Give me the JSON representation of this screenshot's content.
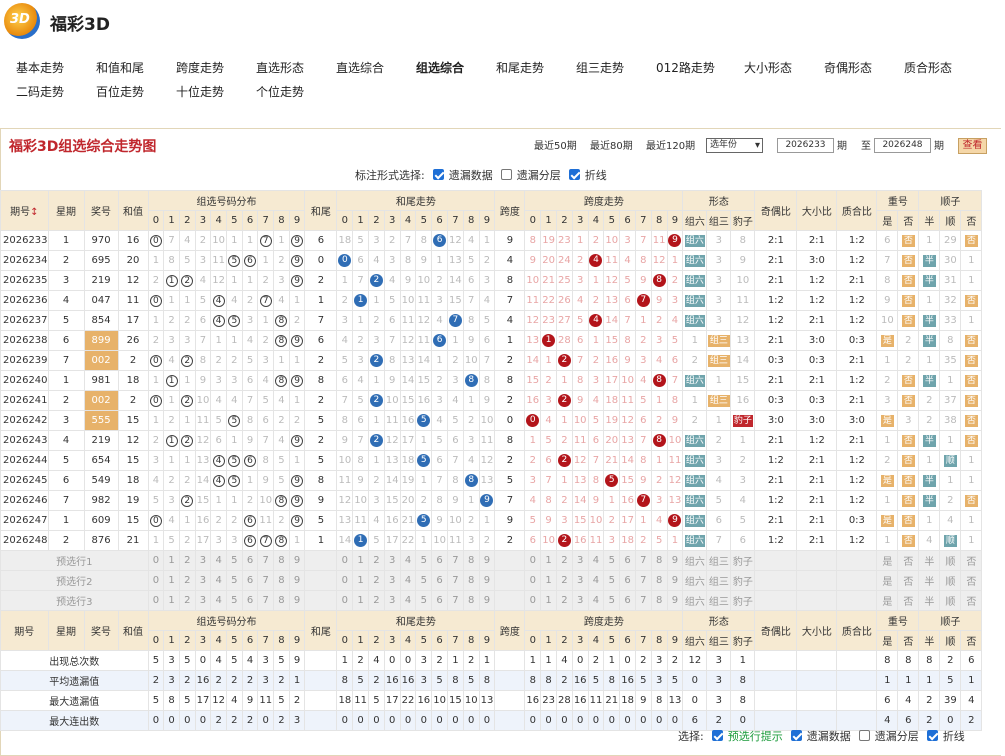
{
  "app": {
    "title": "福彩3D",
    "logo_text": "3D"
  },
  "nav": [
    "基本走势",
    "和值和尾",
    "跨度走势",
    "直选形态",
    "直选综合",
    "组选综合",
    "和尾走势",
    "组三走势",
    "012路走势",
    "大小形态",
    "奇偶形态",
    "质合形态",
    "二码走势",
    "百位走势",
    "十位走势",
    "个位走势"
  ],
  "nav_active": "组选综合",
  "panel": {
    "title": "福彩3D组选综合走势图",
    "recent": [
      "最近50期",
      "最近80期",
      "最近120期"
    ],
    "year_select": "选年份",
    "from": "2026233",
    "period_label": "期",
    "to_label": "至",
    "to": "2026248",
    "query": "查看"
  },
  "mark": {
    "label": "标注形式选择:",
    "opts": [
      {
        "label": "遗漏数据",
        "on": true
      },
      {
        "label": "遗漏分层",
        "on": false
      },
      {
        "label": "折线",
        "on": true
      }
    ]
  },
  "headers": {
    "issue": "期号",
    "week": "星期",
    "prize": "奖号",
    "sum": "和值",
    "dist": "组选号码分布",
    "tail": "和尾",
    "tail_trend": "和尾走势",
    "span": "跨度",
    "span_trend": "跨度走势",
    "form": "形态",
    "form_cols": [
      "组六",
      "组三",
      "豹子"
    ],
    "oe": "奇偶比",
    "bs": "大小比",
    "pc": "质合比",
    "dup": "重号",
    "dup_cols": [
      "是",
      "否"
    ],
    "order": "顺子",
    "order_cols": [
      "半",
      "顺",
      "否"
    ],
    "digits": [
      "0",
      "1",
      "2",
      "3",
      "4",
      "5",
      "6",
      "7",
      "8",
      "9"
    ]
  },
  "rows": [
    {
      "issue": "2026233",
      "week": "1",
      "prize": "970",
      "sum": "16",
      "dist": [
        "⓪",
        "7",
        "4",
        "2",
        "10",
        "1",
        "1",
        "⑦",
        "1",
        "⑨"
      ],
      "tail": "6",
      "tt": [
        "18",
        "5",
        "3",
        "2",
        "7",
        "8",
        "6*",
        "12",
        "4",
        "1"
      ],
      "span": "9",
      "st": [
        "8",
        "19",
        "23",
        "1",
        "2",
        "10",
        "3",
        "7",
        "11",
        "9*"
      ],
      "form": [
        "组六",
        "3",
        "8"
      ],
      "oe": "2:1",
      "bs": "2:1",
      "pc": "1:2",
      "dup": [
        "6",
        "否"
      ],
      "order": [
        "1",
        "29",
        "否"
      ]
    },
    {
      "issue": "2026234",
      "week": "2",
      "prize": "695",
      "sum": "20",
      "dist": [
        "1",
        "8",
        "5",
        "3",
        "11",
        "⑤",
        "⑥",
        "1",
        "2",
        "⑨"
      ],
      "tail": "0",
      "tt": [
        "0*",
        "6",
        "4",
        "3",
        "8",
        "9",
        "1",
        "13",
        "5",
        "2"
      ],
      "span": "4",
      "st": [
        "9",
        "20",
        "24",
        "2",
        "4*",
        "11",
        "4",
        "8",
        "12",
        "1"
      ],
      "form": [
        "组六",
        "3",
        "9"
      ],
      "oe": "2:1",
      "bs": "3:0",
      "pc": "1:2",
      "dup": [
        "7",
        "否"
      ],
      "order": [
        "半",
        "30",
        "1"
      ]
    },
    {
      "issue": "2026235",
      "week": "3",
      "prize": "219",
      "sum": "12",
      "dist": [
        "2",
        "①",
        "②",
        "4",
        "12",
        "1",
        "1",
        "2",
        "3",
        "⑨"
      ],
      "tail": "2",
      "tt": [
        "1",
        "7",
        "2*",
        "4",
        "9",
        "10",
        "2",
        "14",
        "6",
        "3"
      ],
      "span": "8",
      "st": [
        "10",
        "21",
        "25",
        "3",
        "1",
        "12",
        "5",
        "9",
        "8*",
        "2"
      ],
      "form": [
        "组六",
        "3",
        "10"
      ],
      "oe": "2:1",
      "bs": "1:2",
      "pc": "2:1",
      "dup": [
        "8",
        "否"
      ],
      "order": [
        "半",
        "31",
        "1"
      ]
    },
    {
      "issue": "2026236",
      "week": "4",
      "prize": "047",
      "sum": "11",
      "dist": [
        "⓪",
        "1",
        "1",
        "5",
        "④",
        "4",
        "2",
        "⑦",
        "4",
        "1"
      ],
      "tail": "1",
      "tt": [
        "2",
        "1*",
        "1",
        "5",
        "10",
        "11",
        "3",
        "15",
        "7",
        "4"
      ],
      "span": "7",
      "st": [
        "11",
        "22",
        "26",
        "4",
        "2",
        "13",
        "6",
        "7*",
        "9",
        "3"
      ],
      "form": [
        "组六",
        "3",
        "11"
      ],
      "oe": "1:2",
      "bs": "1:2",
      "pc": "1:2",
      "dup": [
        "9",
        "否"
      ],
      "order": [
        "1",
        "32",
        "否"
      ]
    },
    {
      "issue": "2026237",
      "week": "5",
      "prize": "854",
      "sum": "17",
      "dist": [
        "1",
        "2",
        "2",
        "6",
        "④",
        "⑤",
        "3",
        "1",
        "⑧",
        "2"
      ],
      "tail": "7",
      "tt": [
        "3",
        "1",
        "2",
        "6",
        "11",
        "12",
        "4",
        "7*",
        "8",
        "5"
      ],
      "span": "4",
      "st": [
        "12",
        "23",
        "27",
        "5",
        "4*",
        "14",
        "7",
        "1",
        "2",
        "4"
      ],
      "form": [
        "组六",
        "3",
        "12"
      ],
      "oe": "1:2",
      "bs": "2:1",
      "pc": "1:2",
      "dup": [
        "10",
        "否"
      ],
      "order": [
        "半",
        "33",
        "1"
      ]
    },
    {
      "issue": "2026238",
      "week": "6",
      "prize": "899",
      "sum": "26",
      "dist": [
        "2",
        "3",
        "3",
        "7",
        "1",
        "1",
        "4",
        "2",
        "⑧",
        "⑨"
      ],
      "tail": "6",
      "tt": [
        "4",
        "2",
        "3",
        "7",
        "12",
        "11",
        "6*",
        "1",
        "9",
        "6"
      ],
      "span": "1",
      "st": [
        "13",
        "1*",
        "28",
        "6",
        "1",
        "15",
        "8",
        "2",
        "3",
        "5"
      ],
      "form": [
        "1",
        "组三",
        "13"
      ],
      "oe": "2:1",
      "bs": "3:0",
      "pc": "0:3",
      "dup": [
        "是",
        "2"
      ],
      "order": [
        "半",
        "8",
        "否"
      ]
    },
    {
      "issue": "2026239",
      "week": "7",
      "prize": "002",
      "sum": "2",
      "dist": [
        "⓪",
        "4",
        "②",
        "8",
        "2",
        "2",
        "5",
        "3",
        "1",
        "1"
      ],
      "tail": "2",
      "tt": [
        "5",
        "3",
        "2*",
        "8",
        "13",
        "14",
        "1",
        "2",
        "10",
        "7"
      ],
      "span": "2",
      "st": [
        "14",
        "1",
        "2*",
        "7",
        "2",
        "16",
        "9",
        "3",
        "4",
        "6"
      ],
      "form": [
        "2",
        "组三",
        "14"
      ],
      "oe": "0:3",
      "bs": "0:3",
      "pc": "2:1",
      "dup": [
        "1",
        "2"
      ],
      "order": [
        "1",
        "35",
        "否"
      ]
    },
    {
      "issue": "2026240",
      "week": "1",
      "prize": "981",
      "sum": "18",
      "dist": [
        "1",
        "①",
        "1",
        "9",
        "3",
        "3",
        "6",
        "4",
        "⑧",
        "⑨"
      ],
      "tail": "8",
      "tt": [
        "6",
        "4",
        "1",
        "9",
        "14",
        "15",
        "2",
        "3",
        "8*",
        "8"
      ],
      "span": "8",
      "st": [
        "15",
        "2",
        "1",
        "8",
        "3",
        "17",
        "10",
        "4",
        "8*",
        "7"
      ],
      "form": [
        "组六",
        "1",
        "15"
      ],
      "oe": "2:1",
      "bs": "2:1",
      "pc": "1:2",
      "dup": [
        "2",
        "否"
      ],
      "order": [
        "半",
        "1",
        "否"
      ]
    },
    {
      "issue": "2026241",
      "week": "2",
      "prize": "002",
      "sum": "2",
      "dist": [
        "⓪",
        "1",
        "②",
        "10",
        "4",
        "4",
        "7",
        "5",
        "4",
        "1"
      ],
      "tail": "2",
      "tt": [
        "7",
        "5",
        "2*",
        "10",
        "15",
        "16",
        "3",
        "4",
        "1",
        "9"
      ],
      "span": "2",
      "st": [
        "16",
        "3",
        "2*",
        "9",
        "4",
        "18",
        "11",
        "5",
        "1",
        "8"
      ],
      "form": [
        "1",
        "组三",
        "16"
      ],
      "oe": "0:3",
      "bs": "0:3",
      "pc": "2:1",
      "dup": [
        "3",
        "否"
      ],
      "order": [
        "2",
        "37",
        "否"
      ]
    },
    {
      "issue": "2026242",
      "week": "3",
      "prize": "555",
      "sum": "15",
      "dist": [
        "1",
        "2",
        "1",
        "11",
        "5",
        "⑤",
        "8",
        "6",
        "2",
        "2"
      ],
      "tail": "5",
      "tt": [
        "8",
        "6",
        "1",
        "11",
        "16",
        "5*",
        "4",
        "5",
        "2",
        "10"
      ],
      "span": "0",
      "st": [
        "0*",
        "4",
        "1",
        "10",
        "5",
        "19",
        "12",
        "6",
        "2",
        "9"
      ],
      "form": [
        "2",
        "1",
        "豹子"
      ],
      "oe": "3:0",
      "bs": "3:0",
      "pc": "3:0",
      "dup": [
        "是",
        "3"
      ],
      "order": [
        "2",
        "38",
        "否"
      ]
    },
    {
      "issue": "2026243",
      "week": "4",
      "prize": "219",
      "sum": "12",
      "dist": [
        "2",
        "①",
        "②",
        "12",
        "6",
        "1",
        "9",
        "7",
        "4",
        "⑨"
      ],
      "tail": "2",
      "tt": [
        "9",
        "7",
        "2*",
        "12",
        "17",
        "1",
        "5",
        "6",
        "3",
        "11"
      ],
      "span": "8",
      "st": [
        "1",
        "5",
        "2",
        "11",
        "6",
        "20",
        "13",
        "7",
        "8*",
        "10"
      ],
      "form": [
        "组六",
        "2",
        "1"
      ],
      "oe": "2:1",
      "bs": "1:2",
      "pc": "2:1",
      "dup": [
        "1",
        "否"
      ],
      "order": [
        "半",
        "1",
        "否"
      ]
    },
    {
      "issue": "2026244",
      "week": "5",
      "prize": "654",
      "sum": "15",
      "dist": [
        "3",
        "1",
        "1",
        "13",
        "④",
        "⑤",
        "⑥",
        "8",
        "5",
        "1"
      ],
      "tail": "5",
      "tt": [
        "10",
        "8",
        "1",
        "13",
        "18",
        "5*",
        "6",
        "7",
        "4",
        "12"
      ],
      "span": "2",
      "st": [
        "2",
        "6",
        "2*",
        "12",
        "7",
        "21",
        "14",
        "8",
        "1",
        "11"
      ],
      "form": [
        "组六",
        "3",
        "2"
      ],
      "oe": "1:2",
      "bs": "2:1",
      "pc": "1:2",
      "dup": [
        "2",
        "否"
      ],
      "order": [
        "1",
        "顺",
        "1"
      ]
    },
    {
      "issue": "2026245",
      "week": "6",
      "prize": "549",
      "sum": "18",
      "dist": [
        "4",
        "2",
        "2",
        "14",
        "④",
        "⑤",
        "1",
        "9",
        "5",
        "⑨"
      ],
      "tail": "8",
      "tt": [
        "11",
        "9",
        "2",
        "14",
        "19",
        "1",
        "7",
        "8",
        "8*",
        "13"
      ],
      "span": "5",
      "st": [
        "3",
        "7",
        "1",
        "13",
        "8",
        "5*",
        "15",
        "9",
        "2",
        "12"
      ],
      "form": [
        "组六",
        "4",
        "3"
      ],
      "oe": "2:1",
      "bs": "2:1",
      "pc": "1:2",
      "dup": [
        "是",
        "否"
      ],
      "order": [
        "半",
        "1",
        "1"
      ]
    },
    {
      "issue": "2026246",
      "week": "7",
      "prize": "982",
      "sum": "19",
      "dist": [
        "5",
        "3",
        "②",
        "15",
        "1",
        "1",
        "2",
        "10",
        "⑧",
        "⑨"
      ],
      "tail": "9",
      "tt": [
        "12",
        "10",
        "3",
        "15",
        "20",
        "2",
        "8",
        "9",
        "1",
        "9*"
      ],
      "span": "7",
      "st": [
        "4",
        "8",
        "2",
        "14",
        "9",
        "1",
        "16",
        "7*",
        "3",
        "13"
      ],
      "form": [
        "组六",
        "5",
        "4"
      ],
      "oe": "1:2",
      "bs": "2:1",
      "pc": "1:2",
      "dup": [
        "1",
        "否"
      ],
      "order": [
        "半",
        "2",
        "否"
      ]
    },
    {
      "issue": "2026247",
      "week": "1",
      "prize": "609",
      "sum": "15",
      "dist": [
        "⓪",
        "4",
        "1",
        "16",
        "2",
        "2",
        "⑥",
        "11",
        "2",
        "⑨"
      ],
      "tail": "5",
      "tt": [
        "13",
        "11",
        "4",
        "16",
        "21",
        "5*",
        "9",
        "10",
        "2",
        "1"
      ],
      "span": "9",
      "st": [
        "5",
        "9",
        "3",
        "15",
        "10",
        "2",
        "17",
        "1",
        "4",
        "9*"
      ],
      "form": [
        "组六",
        "6",
        "5"
      ],
      "oe": "2:1",
      "bs": "2:1",
      "pc": "0:3",
      "dup": [
        "是",
        "否"
      ],
      "order": [
        "1",
        "4",
        "1"
      ]
    },
    {
      "issue": "2026248",
      "week": "2",
      "prize": "876",
      "sum": "21",
      "dist": [
        "1",
        "5",
        "2",
        "17",
        "3",
        "3",
        "⑥",
        "⑦",
        "⑧",
        "1"
      ],
      "tail": "1",
      "tt": [
        "14",
        "1*",
        "5",
        "17",
        "22",
        "1",
        "10",
        "11",
        "3",
        "2"
      ],
      "span": "2",
      "st": [
        "6",
        "10",
        "2*",
        "16",
        "11",
        "3",
        "18",
        "2",
        "5",
        "1"
      ],
      "form": [
        "组六",
        "7",
        "6"
      ],
      "oe": "1:2",
      "bs": "2:1",
      "pc": "1:2",
      "dup": [
        "1",
        "否"
      ],
      "order": [
        "4",
        "顺",
        "1"
      ]
    }
  ],
  "pre_rows": [
    "预选行1",
    "预选行2",
    "预选行3"
  ],
  "pre_dup": [
    "是",
    "否"
  ],
  "pre_order": [
    "半",
    "顺",
    "否"
  ],
  "stats": [
    {
      "label": "出现总次数",
      "dist": [
        "5",
        "3",
        "5",
        "0",
        "4",
        "5",
        "4",
        "3",
        "5",
        "9"
      ],
      "tt": [
        "1",
        "2",
        "4",
        "0",
        "0",
        "3",
        "2",
        "1",
        "2",
        "1"
      ],
      "st": [
        "1",
        "1",
        "4",
        "0",
        "2",
        "1",
        "0",
        "2",
        "3",
        "2"
      ],
      "form": [
        "12",
        "3",
        "1"
      ],
      "dup": [
        "8",
        "8"
      ],
      "order": [
        "8",
        "2",
        "6"
      ]
    },
    {
      "label": "平均遗漏值",
      "dist": [
        "2",
        "3",
        "2",
        "16",
        "2",
        "2",
        "2",
        "3",
        "2",
        "1"
      ],
      "tt": [
        "8",
        "5",
        "2",
        "16",
        "16",
        "3",
        "5",
        "8",
        "5",
        "8"
      ],
      "st": [
        "8",
        "8",
        "2",
        "16",
        "5",
        "8",
        "16",
        "5",
        "3",
        "5"
      ],
      "form": [
        "0",
        "3",
        "8"
      ],
      "dup": [
        "1",
        "1"
      ],
      "order": [
        "1",
        "5",
        "1"
      ]
    },
    {
      "label": "最大遗漏值",
      "dist": [
        "5",
        "8",
        "5",
        "17",
        "12",
        "4",
        "9",
        "11",
        "5",
        "2"
      ],
      "tt": [
        "18",
        "11",
        "5",
        "17",
        "22",
        "16",
        "10",
        "15",
        "10",
        "13"
      ],
      "st": [
        "16",
        "23",
        "28",
        "16",
        "11",
        "21",
        "18",
        "9",
        "8",
        "13"
      ],
      "form": [
        "0",
        "3",
        "8"
      ],
      "dup": [
        "6",
        "4"
      ],
      "order": [
        "2",
        "39",
        "4"
      ]
    },
    {
      "label": "最大连出数",
      "dist": [
        "0",
        "0",
        "0",
        "0",
        "2",
        "2",
        "2",
        "0",
        "2",
        "3"
      ],
      "tt": [
        "0",
        "0",
        "0",
        "0",
        "0",
        "0",
        "0",
        "0",
        "0",
        "0"
      ],
      "st": [
        "0",
        "0",
        "0",
        "0",
        "0",
        "0",
        "0",
        "0",
        "0",
        "0"
      ],
      "form": [
        "6",
        "2",
        "0"
      ],
      "dup": [
        "4",
        "6"
      ],
      "order": [
        "2",
        "0",
        "2"
      ]
    }
  ],
  "footer": {
    "label": "选择:",
    "opts": [
      {
        "label": "预选行提示",
        "on": true,
        "green": true
      },
      {
        "label": "遗漏数据",
        "on": true
      },
      {
        "label": "遗漏分层",
        "on": false
      },
      {
        "label": "折线",
        "on": true
      }
    ]
  }
}
